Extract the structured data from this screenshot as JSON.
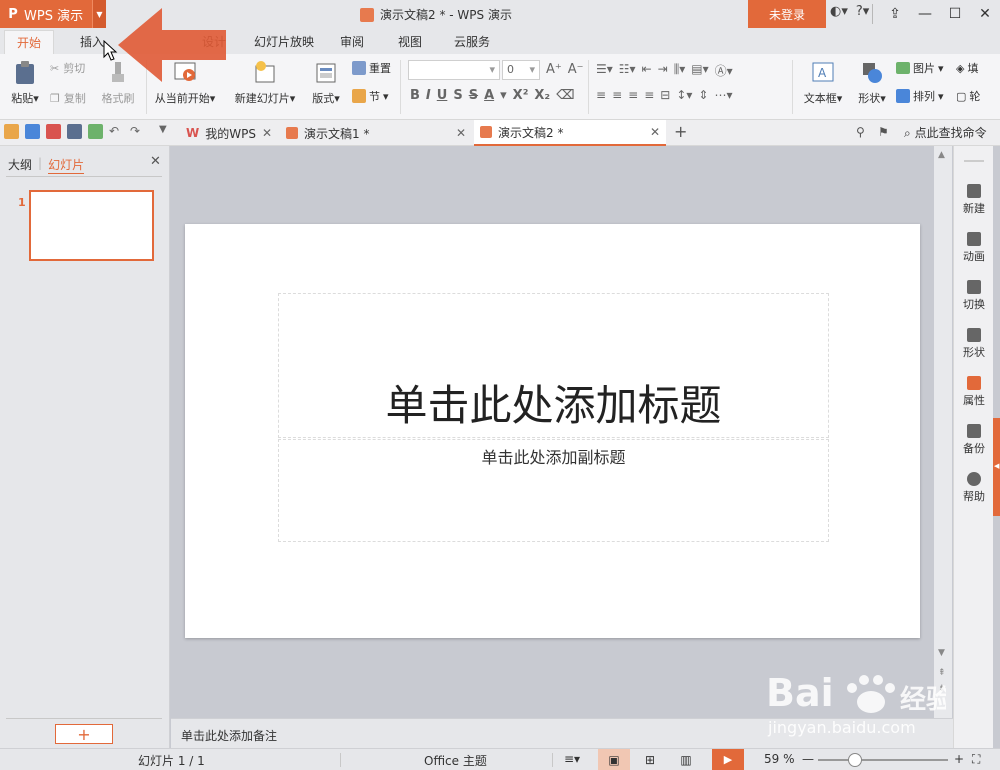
{
  "app": {
    "menu_label": "WPS 演示",
    "window_title": "演示文稿2 * - WPS 演示",
    "login_label": "未登录",
    "help_label": "?"
  },
  "ribbon_tabs": [
    {
      "label": "开始",
      "active": true
    },
    {
      "label": "插入",
      "active": false
    },
    {
      "label": "设计",
      "active": false
    },
    {
      "label": "幻灯片放映",
      "active": false
    },
    {
      "label": "审阅",
      "active": false
    },
    {
      "label": "视图",
      "active": false
    },
    {
      "label": "云服务",
      "active": false
    }
  ],
  "ribbon": {
    "paste": "粘贴",
    "cut": "剪切",
    "copy": "复制",
    "format_painter": "格式刷",
    "from_current": "从当前开始",
    "new_slide": "新建幻灯片",
    "layout": "版式",
    "reset": "重置",
    "section": "节",
    "font_size": "0",
    "textbox": "文本框",
    "shape": "形状",
    "picture": "图片",
    "arrange": "排列",
    "fill": "填",
    "outline": "轮"
  },
  "doc_tabs": [
    {
      "label": "我的WPS",
      "active": false
    },
    {
      "label": "演示文稿1 *",
      "active": false
    },
    {
      "label": "演示文稿2 *",
      "active": true
    }
  ],
  "find_command": "点此查找命令",
  "left_panel": {
    "tab_outline": "大纲",
    "tab_slides": "幻灯片",
    "slide_number": "1",
    "add_label": "+"
  },
  "slide": {
    "title_placeholder": "单击此处添加标题",
    "subtitle_placeholder": "单击此处添加副标题"
  },
  "notes_placeholder": "单击此处添加备注",
  "right_pane": [
    {
      "label": "新建",
      "icon": "new-icon"
    },
    {
      "label": "动画",
      "icon": "animation-icon"
    },
    {
      "label": "切换",
      "icon": "transition-icon"
    },
    {
      "label": "形状",
      "icon": "shape-icon"
    },
    {
      "label": "属性",
      "icon": "property-icon"
    },
    {
      "label": "备份",
      "icon": "backup-icon"
    },
    {
      "label": "帮助",
      "icon": "help-icon"
    }
  ],
  "status": {
    "slide_count": "幻灯片 1 / 1",
    "theme": "Office 主题",
    "zoom": "59 %"
  },
  "watermark": {
    "brand": "Bai",
    "brand2": "经验",
    "url": "jingyan.baidu.com"
  },
  "colors": {
    "accent": "#e2693a",
    "background": "#c8cad1"
  }
}
